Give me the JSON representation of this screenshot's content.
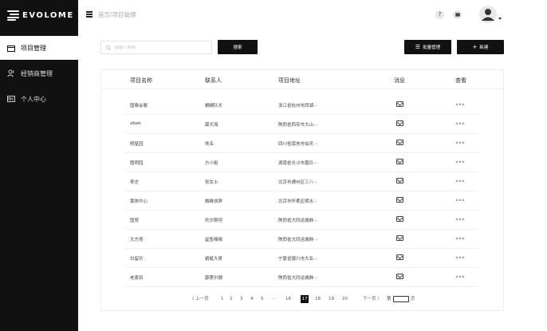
{
  "app": {
    "logo_text": "EVOLOME"
  },
  "sidebar": {
    "items": [
      {
        "label": "项目管理",
        "icon": "folder-icon",
        "active": true
      },
      {
        "label": "经销商管理",
        "icon": "users-icon",
        "active": false
      },
      {
        "label": "个人中心",
        "icon": "id-card-icon",
        "active": false
      }
    ]
  },
  "header": {
    "breadcrumb": "首页/项目管理",
    "help_label": "?"
  },
  "toolbar": {
    "search_placeholder": "请输入搜索",
    "search_button": "搜索",
    "batch_button": "批量管理",
    "new_button": "新建"
  },
  "table": {
    "columns": [
      "项目名称",
      "联系人",
      "项目地址",
      "消息",
      "查看"
    ],
    "rows": [
      {
        "name": "国泰会展",
        "contact": "蜗蜗队长",
        "address": "浙江省杭州市西湖···"
      },
      {
        "name": "abab",
        "contact": "薛大海",
        "address": "陕西省西安市大山···"
      },
      {
        "name": "明星园",
        "contact": "佚名",
        "address": "四川省南充市仙灵···"
      },
      {
        "name": "圆明园",
        "contact": "方小姐",
        "address": "湖南省长沙市嘉玲···"
      },
      {
        "name": "枣庄",
        "contact": "张女士",
        "address": "北京市通州区三八···"
      },
      {
        "name": "黄体中心",
        "contact": "蜘蛛侠胖",
        "address": "北京市怀柔区晒水···"
      },
      {
        "name": "国贸",
        "contact": "托尔斯坦",
        "address": "陕西省大同运城肺···"
      },
      {
        "name": "大方塔",
        "contact": "鲨鱼辣椒",
        "address": "陕西省大同运城肺···"
      },
      {
        "name": "白留珍",
        "contact": "蜻蜓大哥",
        "address": "宁夏省银川市大名···"
      },
      {
        "name": "老麦田",
        "contact": "霹雳尔珊",
        "address": "陕西省大同运城肺···"
      }
    ]
  },
  "pagination": {
    "prev": "〈 上一页",
    "pages": [
      "1",
      "2",
      "3",
      "4",
      "5",
      "···",
      "16",
      "17",
      "18",
      "19",
      "20"
    ],
    "current": "17",
    "next": "下一页 〉",
    "goto_prefix": "第",
    "goto_suffix": "页"
  }
}
